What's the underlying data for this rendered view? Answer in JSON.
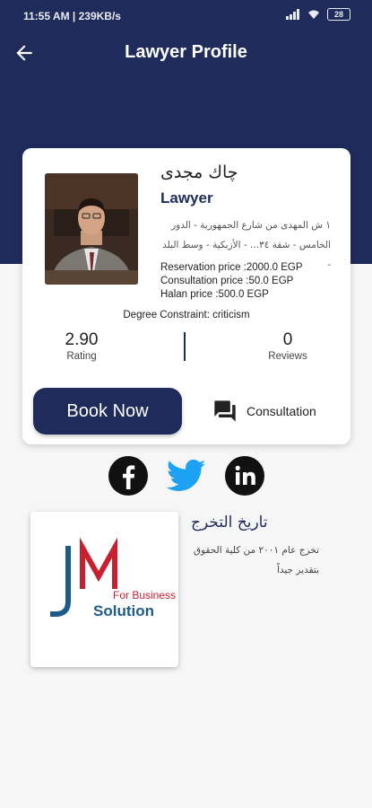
{
  "status_bar": {
    "time_speed": "11:55 AM | 239KB/s",
    "battery": "28"
  },
  "header": {
    "title": "Lawyer Profile"
  },
  "lawyer": {
    "name": "چاك مجدى",
    "role": "Lawyer",
    "address": "١ ش المهدى من شارع الجمهورية - الدور الخامس - شقة ٣٤... - الأزبكية - وسط البلد -",
    "reservation_price": "Reservation price :2000.0 EGP",
    "consultation_price": "Consultation price :50.0 EGP",
    "halan_price": "Halan price :500.0 EGP",
    "degree": "Degree Constraint: criticism"
  },
  "stats": {
    "rating_value": "2.90",
    "rating_label": "Rating",
    "reviews_value": "0",
    "reviews_label": "Reviews"
  },
  "actions": {
    "book_label": "Book Now",
    "consult_label": "Consultation"
  },
  "social": {
    "facebook_color": "#111111",
    "twitter_color": "#1da1f2",
    "linkedin_color": "#111111"
  },
  "education": {
    "title": "تاريخ التخرج",
    "text": "تخرج عام ٢٠٠١ من كلية الحقوق بتقدير جيداً",
    "logo_tagline": "For Business",
    "logo_word": "Solution"
  },
  "colors": {
    "primary": "#1f2b5b",
    "logo_red": "#c8202f",
    "logo_blue": "#1c5c8a"
  }
}
